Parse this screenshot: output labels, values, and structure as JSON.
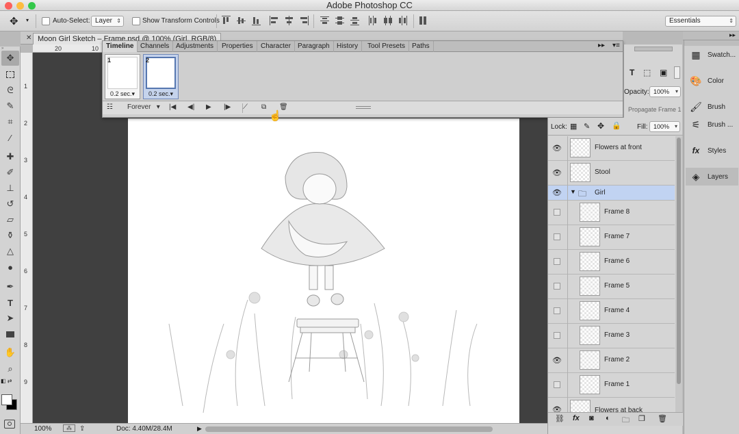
{
  "app": {
    "title": "Adobe Photoshop CC"
  },
  "options_bar": {
    "auto_select_label": "Auto-Select:",
    "auto_select_value": "Layer",
    "show_transform_label": "Show Transform Controls",
    "workspace": "Essentials"
  },
  "document": {
    "tab_title": "Moon Girl Sketch – Frame.psd @ 100% (Girl, RGB/8)",
    "ruler_h": [
      "20",
      "10"
    ],
    "ruler_v": [
      "1",
      "2",
      "3",
      "4",
      "5",
      "6",
      "7",
      "8",
      "9"
    ]
  },
  "timeline_panel": {
    "tabs": [
      "Timeline",
      "Channels",
      "Adjustments",
      "Properties",
      "Character",
      "Paragraph",
      "History",
      "Tool Presets",
      "Paths"
    ],
    "frames": [
      {
        "number": "1",
        "delay": "0.2 sec."
      },
      {
        "number": "2",
        "delay": "0.2 sec."
      }
    ],
    "loop": "Forever"
  },
  "layers_panel": {
    "opacity_label": "Opacity:",
    "opacity_value": "100%",
    "propagate": "Propagate Frame 1",
    "lock_label": "Lock:",
    "fill_label": "Fill:",
    "fill_value": "100%",
    "layers": [
      {
        "name": "Flowers at front",
        "visible": true
      },
      {
        "name": "Stool",
        "visible": true
      },
      {
        "name": "Girl",
        "visible": true,
        "group": true
      },
      {
        "name": "Frame 8",
        "visible": false
      },
      {
        "name": "Frame 7",
        "visible": false
      },
      {
        "name": "Frame 6",
        "visible": false
      },
      {
        "name": "Frame 5",
        "visible": false
      },
      {
        "name": "Frame 4",
        "visible": false
      },
      {
        "name": "Frame 3",
        "visible": false
      },
      {
        "name": "Frame 2",
        "visible": true
      },
      {
        "name": "Frame 1",
        "visible": false
      },
      {
        "name": "Flowers at back",
        "visible": true
      }
    ]
  },
  "dock": {
    "items": [
      "Swatch...",
      "Color",
      "Brush",
      "Brush ...",
      "Styles",
      "Layers"
    ]
  },
  "status_bar": {
    "zoom": "100%",
    "doc_size": "Doc: 4.40M/28.4M"
  }
}
